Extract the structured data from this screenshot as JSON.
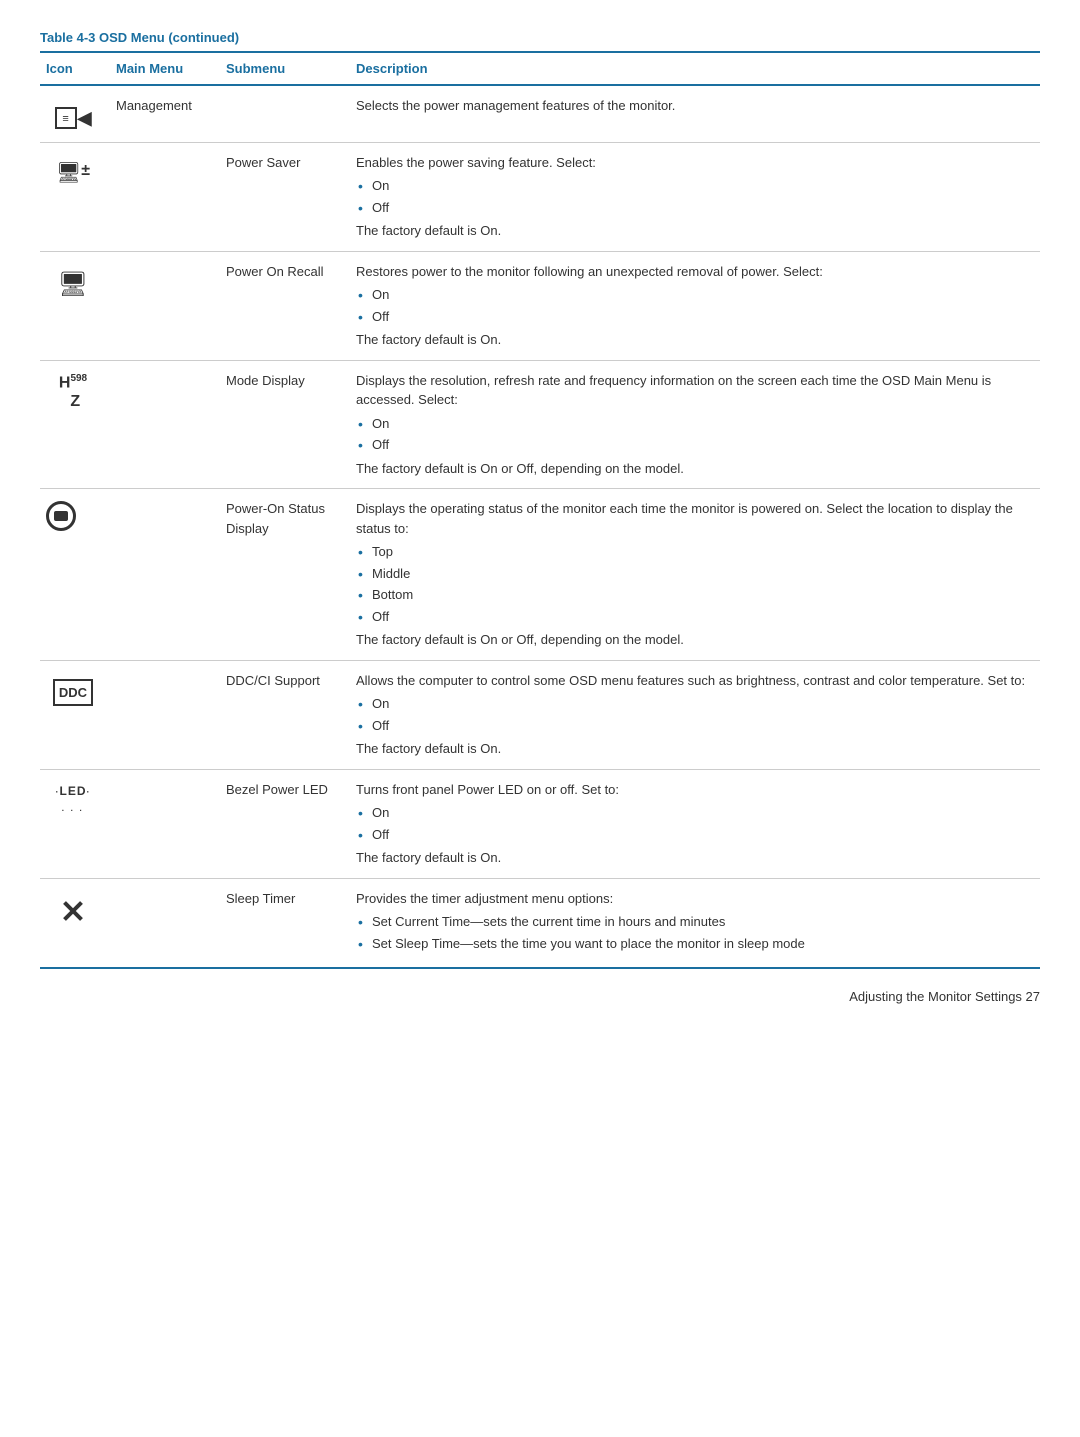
{
  "tableTitle": "Table 4-3  OSD Menu (continued)",
  "columns": {
    "icon": "Icon",
    "mainMenu": "Main Menu",
    "submenu": "Submenu",
    "description": "Description"
  },
  "rows": [
    {
      "id": "management",
      "iconLabel": "management-icon",
      "iconSymbol": "≡▐",
      "mainMenu": "Management",
      "submenu": "",
      "description": "Selects the power management features of the monitor.",
      "bullets": [],
      "note": ""
    },
    {
      "id": "power-saver",
      "iconLabel": "power-saver-icon",
      "iconSymbol": "🖥±",
      "mainMenu": "",
      "submenu": "Power Saver",
      "description": "Enables the power saving feature. Select:",
      "bullets": [
        "On",
        "Off"
      ],
      "note": "The factory default is On."
    },
    {
      "id": "power-on-recall",
      "iconLabel": "power-on-recall-icon",
      "iconSymbol": "🔄",
      "mainMenu": "",
      "submenu": "Power On Recall",
      "description": "Restores power to the monitor following an unexpected removal of power. Select:",
      "bullets": [
        "On",
        "Off"
      ],
      "note": "The factory default is On."
    },
    {
      "id": "mode-display",
      "iconLabel": "mode-display-icon",
      "iconSymbol": "H⁵⁹⁸z",
      "mainMenu": "",
      "submenu": "Mode Display",
      "description": "Displays the resolution, refresh rate and frequency information on the screen each time the OSD Main Menu is accessed. Select:",
      "bullets": [
        "On",
        "Off"
      ],
      "note": "The factory default is On or Off, depending on the model."
    },
    {
      "id": "power-on-status",
      "iconLabel": "power-on-status-icon",
      "iconSymbol": "⬛",
      "mainMenu": "",
      "submenu": "Power-On Status Display",
      "description": "Displays the operating status of the monitor each time the monitor is powered on. Select the location to display the status to:",
      "bullets": [
        "Top",
        "Middle",
        "Bottom",
        "Off"
      ],
      "note": "The factory default is On or Off, depending on the model."
    },
    {
      "id": "ddc-ci",
      "iconLabel": "ddc-ci-icon",
      "iconSymbol": "DDC",
      "mainMenu": "",
      "submenu": "DDC/CI Support",
      "description": "Allows the computer to control some OSD menu features such as brightness, contrast and color temperature. Set to:",
      "bullets": [
        "On",
        "Off"
      ],
      "note": "The factory default is On."
    },
    {
      "id": "bezel-led",
      "iconLabel": "bezel-led-icon",
      "iconSymbol": "·LED·",
      "mainMenu": "",
      "submenu": "Bezel Power LED",
      "description": "Turns front panel Power LED on or off. Set to:",
      "bullets": [
        "On",
        "Off"
      ],
      "note": "The factory default is On."
    },
    {
      "id": "sleep-timer",
      "iconLabel": "sleep-timer-icon",
      "iconSymbol": "✕",
      "mainMenu": "",
      "submenu": "Sleep Timer",
      "description": "Provides the timer adjustment menu options:",
      "bullets": [
        "Set Current Time—sets the current time in hours and minutes",
        "Set Sleep Time—sets the time you want to place the monitor in sleep mode"
      ],
      "note": ""
    }
  ],
  "footer": "Adjusting the Monitor Settings    27"
}
